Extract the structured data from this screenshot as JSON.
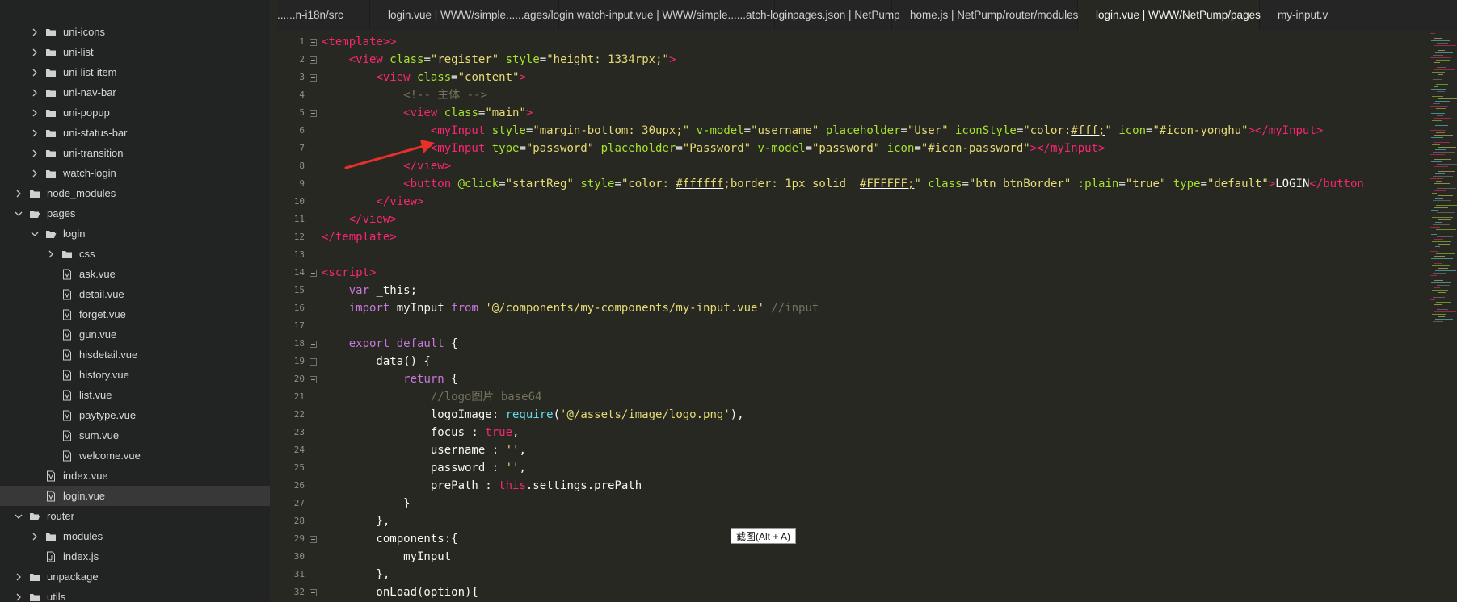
{
  "sidebar": {
    "items": [
      {
        "label": "uni-icons",
        "depth": 2,
        "kind": "folder",
        "expanded": false
      },
      {
        "label": "uni-list",
        "depth": 2,
        "kind": "folder",
        "expanded": false
      },
      {
        "label": "uni-list-item",
        "depth": 2,
        "kind": "folder",
        "expanded": false
      },
      {
        "label": "uni-nav-bar",
        "depth": 2,
        "kind": "folder",
        "expanded": false
      },
      {
        "label": "uni-popup",
        "depth": 2,
        "kind": "folder",
        "expanded": false
      },
      {
        "label": "uni-status-bar",
        "depth": 2,
        "kind": "folder",
        "expanded": false
      },
      {
        "label": "uni-transition",
        "depth": 2,
        "kind": "folder",
        "expanded": false
      },
      {
        "label": "watch-login",
        "depth": 2,
        "kind": "folder",
        "expanded": false
      },
      {
        "label": "node_modules",
        "depth": 1,
        "kind": "folder",
        "expanded": false
      },
      {
        "label": "pages",
        "depth": 1,
        "kind": "folder",
        "expanded": true
      },
      {
        "label": "login",
        "depth": 2,
        "kind": "folder",
        "expanded": true
      },
      {
        "label": "css",
        "depth": 3,
        "kind": "folder",
        "expanded": false
      },
      {
        "label": "ask.vue",
        "depth": 3,
        "kind": "vue"
      },
      {
        "label": "detail.vue",
        "depth": 3,
        "kind": "vue"
      },
      {
        "label": "forget.vue",
        "depth": 3,
        "kind": "vue"
      },
      {
        "label": "gun.vue",
        "depth": 3,
        "kind": "vue"
      },
      {
        "label": "hisdetail.vue",
        "depth": 3,
        "kind": "vue"
      },
      {
        "label": "history.vue",
        "depth": 3,
        "kind": "vue"
      },
      {
        "label": "list.vue",
        "depth": 3,
        "kind": "vue"
      },
      {
        "label": "paytype.vue",
        "depth": 3,
        "kind": "vue"
      },
      {
        "label": "sum.vue",
        "depth": 3,
        "kind": "vue"
      },
      {
        "label": "welcome.vue",
        "depth": 3,
        "kind": "vue"
      },
      {
        "label": "index.vue",
        "depth": 2,
        "kind": "vue"
      },
      {
        "label": "login.vue",
        "depth": 2,
        "kind": "vue",
        "selected": true
      },
      {
        "label": "router",
        "depth": 1,
        "kind": "folder",
        "expanded": true
      },
      {
        "label": "modules",
        "depth": 2,
        "kind": "folder",
        "expanded": false
      },
      {
        "label": "index.js",
        "depth": 2,
        "kind": "js"
      },
      {
        "label": "unpackage",
        "depth": 1,
        "kind": "folder",
        "expanded": false
      },
      {
        "label": "utils",
        "depth": 1,
        "kind": "folder",
        "expanded": false
      }
    ]
  },
  "tabs": [
    {
      "label": "......n-i18n/src",
      "active": false
    },
    {
      "label": "login.vue | WWW/simple......ages/login",
      "active": false
    },
    {
      "label": "watch-input.vue | WWW/simple......atch-login",
      "active": false
    },
    {
      "label": "pages.json | NetPump",
      "active": false
    },
    {
      "label": "home.js | NetPump/router/modules",
      "active": false
    },
    {
      "label": "login.vue | WWW/NetPump/pages",
      "active": true
    },
    {
      "label": "my-input.v",
      "active": false
    }
  ],
  "editor": {
    "lines": [
      {
        "n": "1",
        "fold": true,
        "tokens": [
          [
            "tag",
            "<template>"
          ],
          [
            "tag",
            ">"
          ]
        ]
      },
      {
        "n": "2",
        "fold": true,
        "tokens": [
          [
            "plain",
            "    "
          ],
          [
            "tag",
            "<view "
          ],
          [
            "attr",
            "class"
          ],
          [
            "plain",
            "="
          ],
          [
            "str",
            "\"register\""
          ],
          [
            "plain",
            " "
          ],
          [
            "attr",
            "style"
          ],
          [
            "plain",
            "="
          ],
          [
            "str",
            "\"height: 1334rpx;\""
          ],
          [
            "tag",
            ">"
          ]
        ]
      },
      {
        "n": "3",
        "fold": true,
        "tokens": [
          [
            "plain",
            "        "
          ],
          [
            "tag",
            "<view "
          ],
          [
            "attr",
            "class"
          ],
          [
            "plain",
            "="
          ],
          [
            "str",
            "\"content\""
          ],
          [
            "tag",
            ">"
          ]
        ]
      },
      {
        "n": "4",
        "fold": false,
        "tokens": [
          [
            "plain",
            "            "
          ],
          [
            "com",
            "<!-- 主体 -->"
          ]
        ]
      },
      {
        "n": "5",
        "fold": true,
        "tokens": [
          [
            "plain",
            "            "
          ],
          [
            "tag",
            "<view "
          ],
          [
            "attr",
            "class"
          ],
          [
            "plain",
            "="
          ],
          [
            "str",
            "\"main\""
          ],
          [
            "tag",
            ">"
          ]
        ]
      },
      {
        "n": "6",
        "fold": false,
        "tokens": [
          [
            "plain",
            "                "
          ],
          [
            "tag",
            "<myInput "
          ],
          [
            "attr",
            "style"
          ],
          [
            "plain",
            "="
          ],
          [
            "str",
            "\"margin-bottom: 30upx;\""
          ],
          [
            "plain",
            " "
          ],
          [
            "attr",
            "v-model"
          ],
          [
            "plain",
            "="
          ],
          [
            "str",
            "\"username\""
          ],
          [
            "plain",
            " "
          ],
          [
            "attr",
            "placeholder"
          ],
          [
            "plain",
            "="
          ],
          [
            "str",
            "\"User\""
          ],
          [
            "plain",
            " "
          ],
          [
            "attr",
            "iconStyle"
          ],
          [
            "plain",
            "="
          ],
          [
            "str",
            "\"color:"
          ],
          [
            "ul",
            "#fff;"
          ],
          [
            "str",
            "\""
          ],
          [
            "plain",
            " "
          ],
          [
            "attr",
            "icon"
          ],
          [
            "plain",
            "="
          ],
          [
            "str",
            "\"#icon-yonghu\""
          ],
          [
            "tag",
            "></myInput>"
          ]
        ]
      },
      {
        "n": "7",
        "fold": false,
        "tokens": [
          [
            "plain",
            "                "
          ],
          [
            "tag",
            "<myInput "
          ],
          [
            "attr",
            "type"
          ],
          [
            "plain",
            "="
          ],
          [
            "str",
            "\"password\""
          ],
          [
            "plain",
            " "
          ],
          [
            "attr",
            "placeholder"
          ],
          [
            "plain",
            "="
          ],
          [
            "str",
            "\"Password\""
          ],
          [
            "plain",
            " "
          ],
          [
            "attr",
            "v-model"
          ],
          [
            "plain",
            "="
          ],
          [
            "str",
            "\"password\""
          ],
          [
            "plain",
            " "
          ],
          [
            "attr",
            "icon"
          ],
          [
            "plain",
            "="
          ],
          [
            "str",
            "\"#icon-password\""
          ],
          [
            "tag",
            "></myInput>"
          ]
        ]
      },
      {
        "n": "8",
        "fold": false,
        "tokens": [
          [
            "plain",
            "            "
          ],
          [
            "tag",
            "</view>"
          ]
        ]
      },
      {
        "n": "9",
        "fold": false,
        "tokens": [
          [
            "plain",
            "            "
          ],
          [
            "tag",
            "<button "
          ],
          [
            "attr",
            "@click"
          ],
          [
            "plain",
            "="
          ],
          [
            "str",
            "\"startReg\""
          ],
          [
            "plain",
            " "
          ],
          [
            "attr",
            "style"
          ],
          [
            "plain",
            "="
          ],
          [
            "str",
            "\"color: "
          ],
          [
            "ul",
            "#ffffff"
          ],
          [
            "str",
            ";border: 1px solid  "
          ],
          [
            "ul",
            "#FFFFFF;"
          ],
          [
            "str",
            "\""
          ],
          [
            "plain",
            " "
          ],
          [
            "attr",
            "class"
          ],
          [
            "plain",
            "="
          ],
          [
            "str",
            "\"btn btnBorder\""
          ],
          [
            "plain",
            " "
          ],
          [
            "attr",
            ":plain"
          ],
          [
            "plain",
            "="
          ],
          [
            "str",
            "\"true\""
          ],
          [
            "plain",
            " "
          ],
          [
            "attr",
            "type"
          ],
          [
            "plain",
            "="
          ],
          [
            "str",
            "\"default\""
          ],
          [
            "tag",
            ">"
          ],
          [
            "plain",
            "LOGIN"
          ],
          [
            "tag",
            "</button"
          ]
        ]
      },
      {
        "n": "10",
        "fold": false,
        "tokens": [
          [
            "plain",
            "        "
          ],
          [
            "tag",
            "</view>"
          ]
        ]
      },
      {
        "n": "11",
        "fold": false,
        "tokens": [
          [
            "plain",
            "    "
          ],
          [
            "tag",
            "</view>"
          ]
        ]
      },
      {
        "n": "12",
        "fold": false,
        "tokens": [
          [
            "tag",
            "</template>"
          ]
        ]
      },
      {
        "n": "13",
        "fold": false,
        "tokens": []
      },
      {
        "n": "14",
        "fold": true,
        "tokens": [
          [
            "tag",
            "<script>"
          ]
        ]
      },
      {
        "n": "15",
        "fold": false,
        "tokens": [
          [
            "plain",
            "    "
          ],
          [
            "kw",
            "var"
          ],
          [
            "plain",
            " _this;"
          ]
        ]
      },
      {
        "n": "16",
        "fold": false,
        "tokens": [
          [
            "plain",
            "    "
          ],
          [
            "kw",
            "import"
          ],
          [
            "plain",
            " myInput "
          ],
          [
            "kw",
            "from"
          ],
          [
            "plain",
            " "
          ],
          [
            "str",
            "'@/components/my-components/my-input.vue'"
          ],
          [
            "plain",
            " "
          ],
          [
            "com",
            "//input"
          ]
        ]
      },
      {
        "n": "17",
        "fold": false,
        "tokens": []
      },
      {
        "n": "18",
        "fold": true,
        "tokens": [
          [
            "plain",
            "    "
          ],
          [
            "kw",
            "export default"
          ],
          [
            "plain",
            " {"
          ]
        ]
      },
      {
        "n": "19",
        "fold": true,
        "tokens": [
          [
            "plain",
            "        data() {"
          ]
        ]
      },
      {
        "n": "20",
        "fold": true,
        "tokens": [
          [
            "plain",
            "            "
          ],
          [
            "kw",
            "return"
          ],
          [
            "plain",
            " {"
          ]
        ]
      },
      {
        "n": "21",
        "fold": false,
        "tokens": [
          [
            "plain",
            "                "
          ],
          [
            "com",
            "//logo图片 base64"
          ]
        ]
      },
      {
        "n": "22",
        "fold": false,
        "tokens": [
          [
            "plain",
            "                logoImage: "
          ],
          [
            "fn",
            "require"
          ],
          [
            "plain",
            "("
          ],
          [
            "str",
            "'@/assets/image/logo.png'"
          ],
          [
            "plain",
            "),"
          ]
        ]
      },
      {
        "n": "23",
        "fold": false,
        "tokens": [
          [
            "plain",
            "                focus : "
          ],
          [
            "tag",
            "true"
          ],
          [
            "plain",
            ","
          ]
        ]
      },
      {
        "n": "24",
        "fold": false,
        "tokens": [
          [
            "plain",
            "                username : "
          ],
          [
            "str",
            "''"
          ],
          [
            "plain",
            ","
          ]
        ]
      },
      {
        "n": "25",
        "fold": false,
        "tokens": [
          [
            "plain",
            "                password : "
          ],
          [
            "str",
            "''"
          ],
          [
            "plain",
            ","
          ]
        ]
      },
      {
        "n": "26",
        "fold": false,
        "tokens": [
          [
            "plain",
            "                prePath : "
          ],
          [
            "tag",
            "this"
          ],
          [
            "plain",
            ".settings.prePath"
          ]
        ]
      },
      {
        "n": "27",
        "fold": false,
        "tokens": [
          [
            "plain",
            "            }"
          ]
        ]
      },
      {
        "n": "28",
        "fold": false,
        "tokens": [
          [
            "plain",
            "        },"
          ]
        ]
      },
      {
        "n": "29",
        "fold": true,
        "tokens": [
          [
            "plain",
            "        components:{"
          ]
        ]
      },
      {
        "n": "30",
        "fold": false,
        "tokens": [
          [
            "plain",
            "            myInput"
          ]
        ]
      },
      {
        "n": "31",
        "fold": false,
        "tokens": [
          [
            "plain",
            "        },"
          ]
        ]
      },
      {
        "n": "32",
        "fold": true,
        "tokens": [
          [
            "plain",
            "        onLoad(option){"
          ]
        ]
      }
    ]
  },
  "tooltip": {
    "text": "截图(Alt + A)"
  },
  "icons": {
    "chevron_right": "chevron-right-icon",
    "chevron_down": "chevron-down-icon",
    "folder": "folder-icon",
    "vue_file": "vue-file-icon",
    "js_file": "js-file-icon"
  },
  "colors": {
    "tag": "#f92672",
    "attr": "#a6e22e",
    "string": "#e6db74",
    "comment": "#75715e",
    "keyword": "#c678dd",
    "arrow": "#e8302a"
  }
}
